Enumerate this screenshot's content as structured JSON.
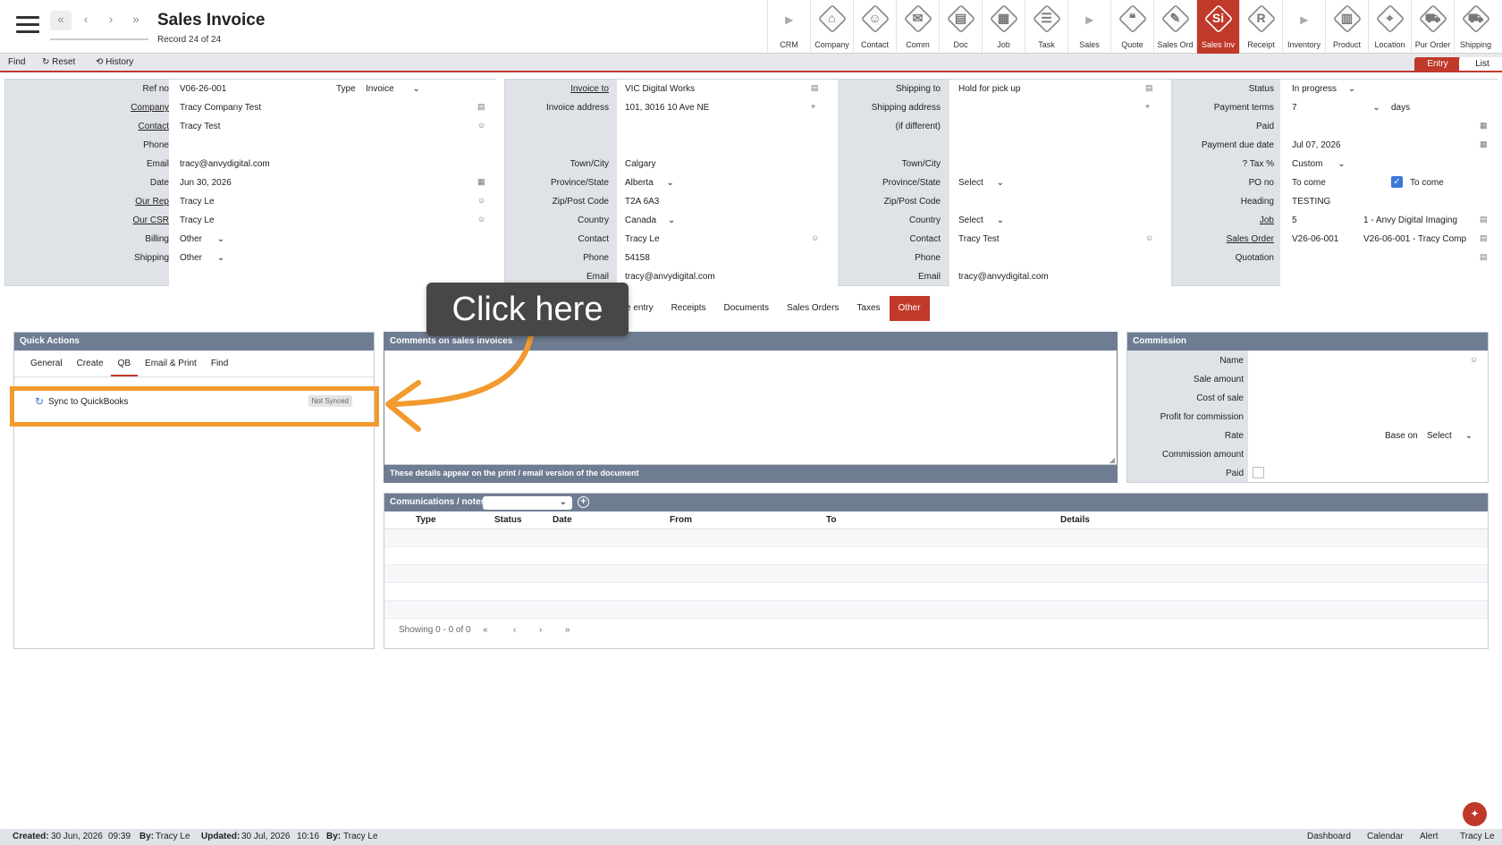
{
  "header": {
    "title": "Sales Invoice",
    "record": "Record 24 of 24"
  },
  "nav": [
    "«",
    "‹",
    "›",
    "»"
  ],
  "modules": [
    {
      "label": "CRM",
      "glyph": "▸",
      "kind": "arrow"
    },
    {
      "label": "Company",
      "glyph": "⌂"
    },
    {
      "label": "Contact",
      "glyph": "☺"
    },
    {
      "label": "Comm",
      "glyph": "✉"
    },
    {
      "label": "Doc",
      "glyph": "▤"
    },
    {
      "label": "Job",
      "glyph": "▦"
    },
    {
      "label": "Task",
      "glyph": "☰"
    },
    {
      "label": "Sales",
      "glyph": "▸",
      "kind": "arrow"
    },
    {
      "label": "Quote",
      "glyph": "❝"
    },
    {
      "label": "Sales Ord",
      "glyph": "✎"
    },
    {
      "label": "Sales Inv",
      "glyph": "Si",
      "kind": "active"
    },
    {
      "label": "Receipt",
      "glyph": "R"
    },
    {
      "label": "Inventory",
      "glyph": "▸",
      "kind": "arrow"
    },
    {
      "label": "Product",
      "glyph": "▥"
    },
    {
      "label": "Location",
      "glyph": "⌖"
    },
    {
      "label": "Pur Order",
      "glyph": "⛟"
    },
    {
      "label": "Shipping",
      "glyph": "⛟"
    }
  ],
  "toolbar": {
    "find": "Find",
    "reset": "Reset",
    "history": "History",
    "entry": "Entry",
    "list": "List",
    "reset_glyph": "↻",
    "history_glyph": "⟲"
  },
  "form": {
    "ref_no_label": "Ref no",
    "ref_no": "V06-26-001",
    "type_label": "Type",
    "type": "Invoice",
    "company_label": "Company",
    "company": "Tracy Company Test",
    "contact_label": "Contact",
    "contact": "Tracy Test",
    "phone_label": "Phone",
    "phone": "",
    "email_label": "Email",
    "email": "tracy@anvydigital.com",
    "date_label": "Date",
    "date": "Jun 30, 2026",
    "rep_label": "Our Rep",
    "rep": "Tracy Le",
    "csr_label": "Our CSR",
    "csr": "Tracy Le",
    "billing_label": "Billing",
    "billing": "Other",
    "shipping_label": "Shipping",
    "shipping": "Other"
  },
  "invoice_to": {
    "invoice_to_label": "Invoice to",
    "invoice_to": "VIC Digital Works",
    "address_label": "Invoice address",
    "address": "101, 3016 10 Ave NE",
    "town_label": "Town/City",
    "town": "Calgary",
    "province_label": "Province/State",
    "province": "Alberta",
    "zip_label": "Zip/Post Code",
    "zip": "T2A 6A3",
    "country_label": "Country",
    "country": "Canada",
    "contact_label": "Contact",
    "contact": "Tracy Le",
    "phone_label": "Phone",
    "phone": "54158",
    "email_label": "Email",
    "email": "tracy@anvydigital.com"
  },
  "shipping_to": {
    "shipping_to_label": "Shipping to",
    "shipping_to": "Hold for pick up",
    "address_label": "Shipping address",
    "address_label2": "(if different)",
    "town_label": "Town/City",
    "province_label": "Province/State",
    "province": "Select",
    "zip_label": "Zip/Post Code",
    "country_label": "Country",
    "country": "Select",
    "contact_label": "Contact",
    "contact": "Tracy Test",
    "phone_label": "Phone",
    "email_label": "Email",
    "email": "tracy@anvydigital.com"
  },
  "status": {
    "status_label": "Status",
    "status": "In progress",
    "terms_label": "Payment terms",
    "terms": "7",
    "days": "days",
    "paid_label": "Paid",
    "due_label": "Payment due date",
    "due": "Jul 07, 2026",
    "tax_label": "Tax %",
    "tax": "Custom",
    "tax_help": "?",
    "po_label": "PO no",
    "po": "To come",
    "po_check_label": "To come",
    "heading_label": "Heading",
    "heading": "TESTING",
    "job_label": "Job",
    "job": "5",
    "job_name": "1 - Anvy Digital Imaging",
    "so_label": "Sales Order",
    "so": "V26-06-001",
    "so_name": "V26-06-001 - Tracy Comp",
    "quote_label": "Quotation"
  },
  "subtabs": [
    "e entry",
    "Receipts",
    "Documents",
    "Sales Orders",
    "Taxes",
    "Other"
  ],
  "quick_actions": {
    "title": "Quick Actions",
    "tabs": [
      "General",
      "Create",
      "QB",
      "Email & Print",
      "Find"
    ],
    "sync_label": "Sync to QuickBooks",
    "sync_status": "Not Synced"
  },
  "comments": {
    "title": "Comments on sales invoices",
    "note": "These details appear on the print / email version of the document"
  },
  "comms": {
    "title": "Comunications / notes",
    "columns": [
      "Type",
      "Status",
      "Date",
      "From",
      "To",
      "Details"
    ],
    "paging": "Showing 0 - 0 of 0",
    "pager": [
      "«",
      "‹",
      "›",
      "»"
    ]
  },
  "commission": {
    "title": "Commission",
    "name_label": "Name",
    "sale_label": "Sale amount",
    "cost_label": "Cost of sale",
    "profit_label": "Profit for commission",
    "rate_label": "Rate",
    "base_label": "Base on",
    "base": "Select",
    "amount_label": "Commission amount",
    "paid_label": "Paid"
  },
  "footer": {
    "created_label": "Created:",
    "created": "30 Jun, 2026",
    "created_time": "09:39",
    "by_label": "By:",
    "created_by": "Tracy Le",
    "updated_label": "Updated:",
    "updated": "30 Jul, 2026",
    "updated_time": "10:16",
    "updated_by": "Tracy Le",
    "links": [
      "Dashboard",
      "Calendar",
      "Alert",
      "Tracy Le"
    ]
  },
  "overlay": {
    "callout": "Click here"
  },
  "colors": {
    "accent": "#c0392b",
    "highlight": "#f29a2e",
    "panel_head": "#6f7d93"
  }
}
